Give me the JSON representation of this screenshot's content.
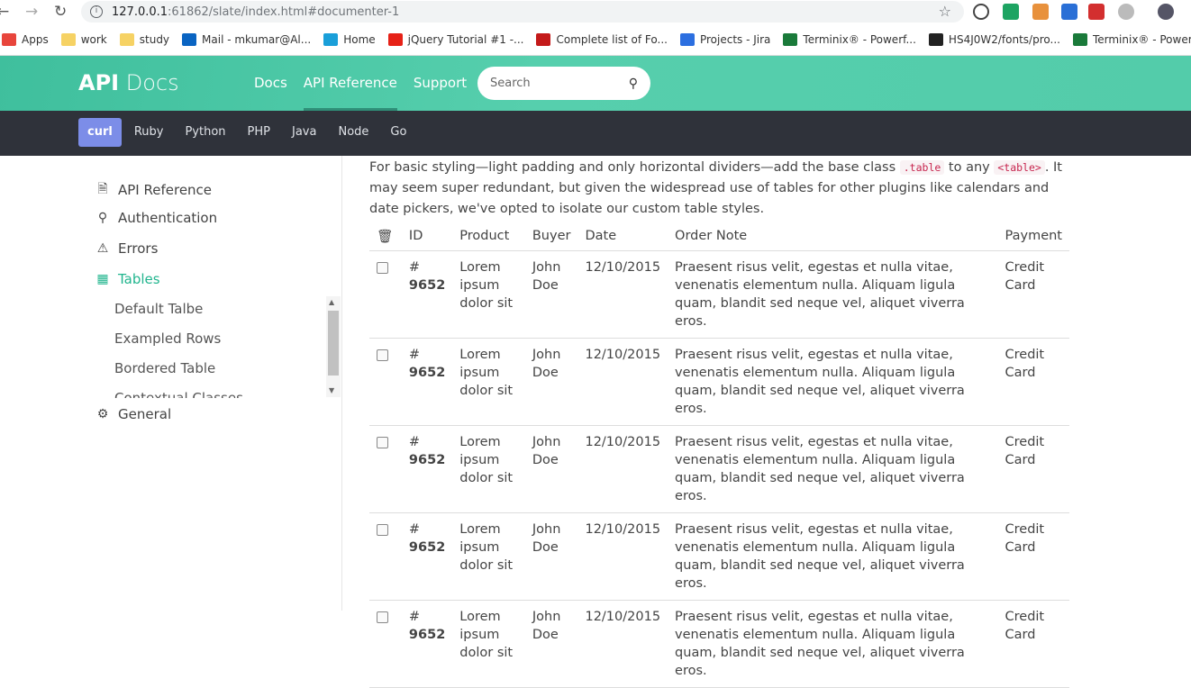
{
  "browser": {
    "url_host": "127.0.0.1",
    "url_rest": ":61862/slate/index.html#documenter-1",
    "bookmarks": [
      {
        "label": "Apps",
        "icon": "apps-grid-icon",
        "color": "#e8453c"
      },
      {
        "label": "work",
        "icon": "folder-icon",
        "color": "#f6d264"
      },
      {
        "label": "study",
        "icon": "folder-icon",
        "color": "#f6d264"
      },
      {
        "label": "Mail - mkumar@Al...",
        "icon": "outlook-icon",
        "color": "#0a64c2"
      },
      {
        "label": "Home",
        "icon": "k-icon",
        "color": "#1a9fd9"
      },
      {
        "label": "jQuery Tutorial #1 -...",
        "icon": "youtube-icon",
        "color": "#e62117"
      },
      {
        "label": "Complete list of Fo...",
        "icon": "red-circle-icon",
        "color": "#c41a1a"
      },
      {
        "label": "Projects - Jira",
        "icon": "jira-icon",
        "color": "#2c6fe0"
      },
      {
        "label": "Terminix® - Powerf...",
        "icon": "terminix-icon",
        "color": "#1a7a3a"
      },
      {
        "label": "HS4J0W2/fonts/pro...",
        "icon": "github-icon",
        "color": "#222222"
      },
      {
        "label": "Terminix® - Powerf...",
        "icon": "terminix-icon",
        "color": "#1a7a3a"
      }
    ]
  },
  "header": {
    "logo_bold": "API",
    "logo_light": "Docs",
    "nav": [
      "Docs",
      "API Reference",
      "Support"
    ],
    "active_nav": "API Reference",
    "search_placeholder": "Search",
    "accent": "#53ccaa"
  },
  "languages": {
    "items": [
      "curl",
      "Ruby",
      "Python",
      "PHP",
      "Java",
      "Node",
      "Go"
    ],
    "active": "curl",
    "active_color": "#7c8de8"
  },
  "sidebar": {
    "items": [
      {
        "label": "API Reference",
        "icon": "document-icon"
      },
      {
        "label": "Authentication",
        "icon": "key-icon"
      },
      {
        "label": "Errors",
        "icon": "warning-icon"
      },
      {
        "label": "Tables",
        "icon": "table-icon"
      },
      {
        "label": "General",
        "icon": "gear-icon"
      }
    ],
    "active": "Tables",
    "sub_items": [
      "Default Talbe",
      "Exampled Rows",
      "Bordered Table",
      "Contextual Classes"
    ]
  },
  "content": {
    "intro_1": "For basic styling—light padding and only horizontal dividers—add the base class",
    "code_1": ".table",
    "intro_2": "to any",
    "code_2": "<table>",
    "intro_3": ". It may seem super redundant, but given the widespread use of tables for other plugins like calendars and date pickers, we've opted to isolate our custom table styles.",
    "table": {
      "headers": [
        "ID",
        "Product",
        "Buyer",
        "Date",
        "Order Note",
        "Payment"
      ],
      "rows": [
        {
          "id_prefix": "#",
          "id": "9652",
          "product": "Lorem ipsum dolor sit",
          "buyer": "John Doe",
          "date": "12/10/2015",
          "note": "Praesent risus velit, egestas et nulla vitae, venenatis elementum nulla. Aliquam ligula quam, blandit sed neque vel, aliquet viverra eros.",
          "payment": "Credit Card"
        },
        {
          "id_prefix": "#",
          "id": "9652",
          "product": "Lorem ipsum dolor sit",
          "buyer": "John Doe",
          "date": "12/10/2015",
          "note": "Praesent risus velit, egestas et nulla vitae, venenatis elementum nulla. Aliquam ligula quam, blandit sed neque vel, aliquet viverra eros.",
          "payment": "Credit Card"
        },
        {
          "id_prefix": "#",
          "id": "9652",
          "product": "Lorem ipsum dolor sit",
          "buyer": "John Doe",
          "date": "12/10/2015",
          "note": "Praesent risus velit, egestas et nulla vitae, venenatis elementum nulla. Aliquam ligula quam, blandit sed neque vel, aliquet viverra eros.",
          "payment": "Credit Card"
        },
        {
          "id_prefix": "#",
          "id": "9652",
          "product": "Lorem ipsum dolor sit",
          "buyer": "John Doe",
          "date": "12/10/2015",
          "note": "Praesent risus velit, egestas et nulla vitae, venenatis elementum nulla. Aliquam ligula quam, blandit sed neque vel, aliquet viverra eros.",
          "payment": "Credit Card"
        },
        {
          "id_prefix": "#",
          "id": "9652",
          "product": "Lorem ipsum dolor sit",
          "buyer": "John Doe",
          "date": "12/10/2015",
          "note": "Praesent risus velit, egestas et nulla vitae, venenatis elementum nulla. Aliquam ligula quam, blandit sed neque vel, aliquet viverra eros.",
          "payment": "Credit Card"
        }
      ]
    }
  }
}
